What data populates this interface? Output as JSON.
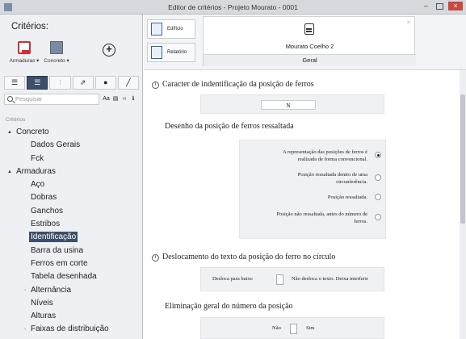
{
  "window": {
    "title": "Editor de critérios - Projeto Mourato - 0001"
  },
  "left_panel": {
    "title": "Critérios:",
    "big_buttons": [
      {
        "label": "Armaduras ▾",
        "icon": "armaduras-icon"
      },
      {
        "label": "Concreto ▾",
        "icon": "concreto-icon"
      },
      {
        "label": "",
        "icon": "add-icon"
      }
    ],
    "toolbar": [
      "☰",
      "☰",
      "⁝",
      "⇗",
      "●",
      "╱"
    ],
    "search": {
      "placeholder": "Pesquisar",
      "options": [
        "Aa",
        "▤",
        "‹‹",
        "ℹ"
      ]
    },
    "tree_header": "Critérios",
    "tree": [
      {
        "label": "Concreto",
        "level": 0,
        "arrow": "▲"
      },
      {
        "label": "Dados Gerais",
        "level": 1,
        "arrow": ""
      },
      {
        "label": "Fck",
        "level": 1,
        "arrow": ""
      },
      {
        "label": "Armaduras",
        "level": 0,
        "arrow": "▲"
      },
      {
        "label": "Aço",
        "level": 1,
        "arrow": ""
      },
      {
        "label": "Dobras",
        "level": 1,
        "arrow": ""
      },
      {
        "label": "Ganchos",
        "level": 1,
        "arrow": ""
      },
      {
        "label": "Estribos",
        "level": 1,
        "arrow": ""
      },
      {
        "label": "Identificação",
        "level": 1,
        "arrow": "",
        "selected": true
      },
      {
        "label": "Barra da usina",
        "level": 1,
        "arrow": ""
      },
      {
        "label": "Ferros em corte",
        "level": 1,
        "arrow": ""
      },
      {
        "label": "Tabela desenhada",
        "level": 1,
        "arrow": ""
      },
      {
        "label": "Alternância",
        "level": 1,
        "arrow": "›"
      },
      {
        "label": "Níveis",
        "level": 1,
        "arrow": ""
      },
      {
        "label": "Alturas",
        "level": 1,
        "arrow": ""
      },
      {
        "label": "Faixas de distribuição",
        "level": 1,
        "arrow": "›"
      }
    ]
  },
  "right_panel": {
    "tabs": [
      {
        "label": "Edifício",
        "icon": "building-icon"
      },
      {
        "label": "Relatório",
        "icon": "report-icon"
      }
    ],
    "node": {
      "name": "Mourato Coelho 2",
      "tab": "Geral",
      "icon": "building-icon"
    },
    "sections": {
      "caracter": {
        "title": "Caracter de indentificação da posição de ferros",
        "value": "N"
      },
      "desenho": {
        "title": "Desenho da posição de ferros ressaltada",
        "options": [
          {
            "text1": "A representação das posições de ferros é",
            "text2": "realizada de forma convencional.",
            "selected": true
          },
          {
            "text1": "Posição ressaltada dentro de uma",
            "text2": "circunferência.",
            "selected": false
          },
          {
            "text1": "Posição ressaltada.",
            "text2": "",
            "selected": false
          },
          {
            "text1": "Posição não ressaltada, antes do número de",
            "text2": "ferros.",
            "selected": false
          }
        ]
      },
      "deslocamento": {
        "title": "Deslocamento do texto da posição do ferro no círculo",
        "left_label": "Desloca para baixo",
        "right_label": "Não desloca o texto. Deixa interferir"
      },
      "eliminacao": {
        "title": "Eliminação geral do número da posição",
        "left_label": "Não",
        "right_label": "Sim"
      }
    }
  },
  "colors": {
    "selection": "#3d4e68",
    "close_button": "#c94a3f",
    "accent_blue": "#3a62a8"
  }
}
